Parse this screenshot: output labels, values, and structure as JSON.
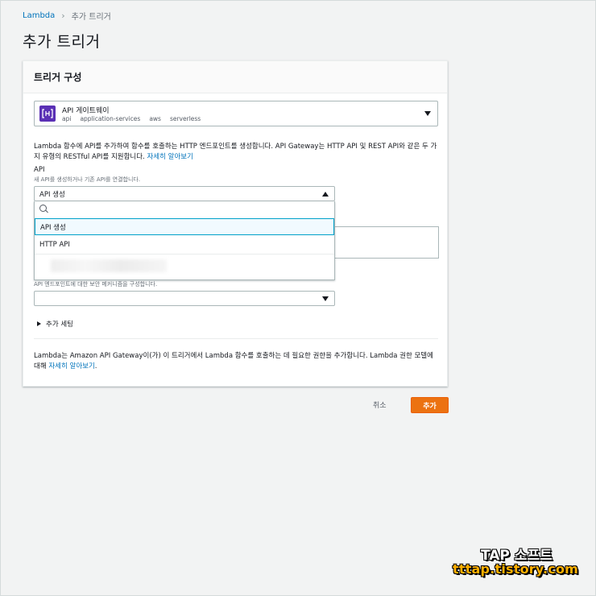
{
  "breadcrumb": {
    "root": "Lambda",
    "current": "추가 트리거"
  },
  "page_title": "추가 트리거",
  "panel": {
    "title": "트리거 구성",
    "trigger": {
      "name": "API 게이트웨이",
      "tags": [
        "api",
        "application-services",
        "aws",
        "serverless"
      ],
      "logo_icon": "api-gateway-icon",
      "logo_color": "#5a30b5"
    },
    "description": "Lambda 함수에 API를 추가하여 함수를 호출하는 HTTP 엔드포인트를 생성합니다. API Gateway는 HTTP API 및 REST API와 같은 두 가지 유형의 RESTful API를 지원합니다.",
    "description_link": "자세히 알아보기",
    "api": {
      "label": "API",
      "hint": "새 API를 생성하거나 기존 API를 연결합니다.",
      "selected": "API 생성",
      "search_placeholder": "",
      "options": [
        "API 생성",
        "HTTP API"
      ]
    },
    "security": {
      "hint": "API 엔드포인트에 대한 보안 메커니즘을 구성합니다.",
      "selected": ""
    },
    "extra_settings": "추가 세팅",
    "footer_note": "Lambda는 Amazon API Gateway이(가) 이 트리거에서 Lambda 함수를 호출하는 데 필요한 권한을 추가합니다. Lambda 권한 모델에 대해",
    "footer_link": "자세히 알아보기",
    "footer_end": "."
  },
  "actions": {
    "cancel": "취소",
    "add": "추가"
  },
  "watermark": {
    "line1": "TAP 소프트",
    "line2": "tttap.tistory.com"
  },
  "colors": {
    "accent": "#ec7211",
    "link": "#0073bb",
    "selected_border": "#00a1c9"
  }
}
